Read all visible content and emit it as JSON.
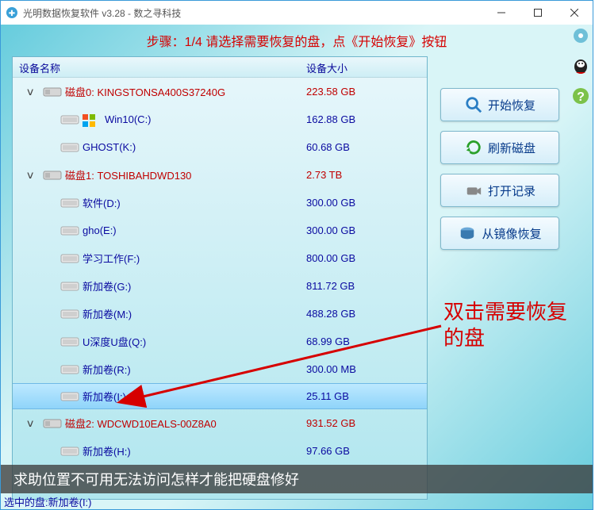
{
  "window": {
    "title": "光明数据恢复软件 v3.28 - 数之寻科技"
  },
  "step_hint": "步骤：1/4 请选择需要恢复的盘，点《开始恢复》按钮",
  "columns": {
    "name": "设备名称",
    "size": "设备大小"
  },
  "tree": [
    {
      "type": "disk",
      "label": "磁盘0: KINGSTONSA400S37240G",
      "size": "223.58 GB",
      "expanded": true
    },
    {
      "type": "vol",
      "win": true,
      "label": "Win10(C:)",
      "size": "162.88 GB"
    },
    {
      "type": "vol",
      "label": "GHOST(K:)",
      "size": "60.68 GB"
    },
    {
      "type": "disk",
      "label": "磁盘1: TOSHIBAHDWD130",
      "size": "2.73 TB",
      "expanded": true
    },
    {
      "type": "vol",
      "label": "软件(D:)",
      "size": "300.00 GB"
    },
    {
      "type": "vol",
      "label": "gho(E:)",
      "size": "300.00 GB"
    },
    {
      "type": "vol",
      "label": "学习工作(F:)",
      "size": "800.00 GB"
    },
    {
      "type": "vol",
      "label": "新加卷(G:)",
      "size": "811.72 GB"
    },
    {
      "type": "vol",
      "label": "新加卷(M:)",
      "size": "488.28 GB"
    },
    {
      "type": "vol",
      "label": "U深度U盘(Q:)",
      "size": "68.99 GB"
    },
    {
      "type": "vol",
      "label": "新加卷(R:)",
      "size": "300.00 MB"
    },
    {
      "type": "vol",
      "label": "新加卷(I:)",
      "size": "25.11 GB",
      "selected": true
    },
    {
      "type": "disk",
      "label": "磁盘2: WDCWD10EALS-00Z8A0",
      "size": "931.52 GB",
      "expanded": true
    },
    {
      "type": "vol",
      "label": "新加卷(H:)",
      "size": "97.66 GB"
    }
  ],
  "buttons": {
    "start": "开始恢复",
    "refresh": "刷新磁盘",
    "open_log": "打开记录",
    "from_image": "从镜像恢复"
  },
  "annotation": "双击需要恢复的盘",
  "caption": "求助位置不可用无法访问怎样才能把硬盘修好",
  "status": "选中的盘:新加卷(I:)"
}
